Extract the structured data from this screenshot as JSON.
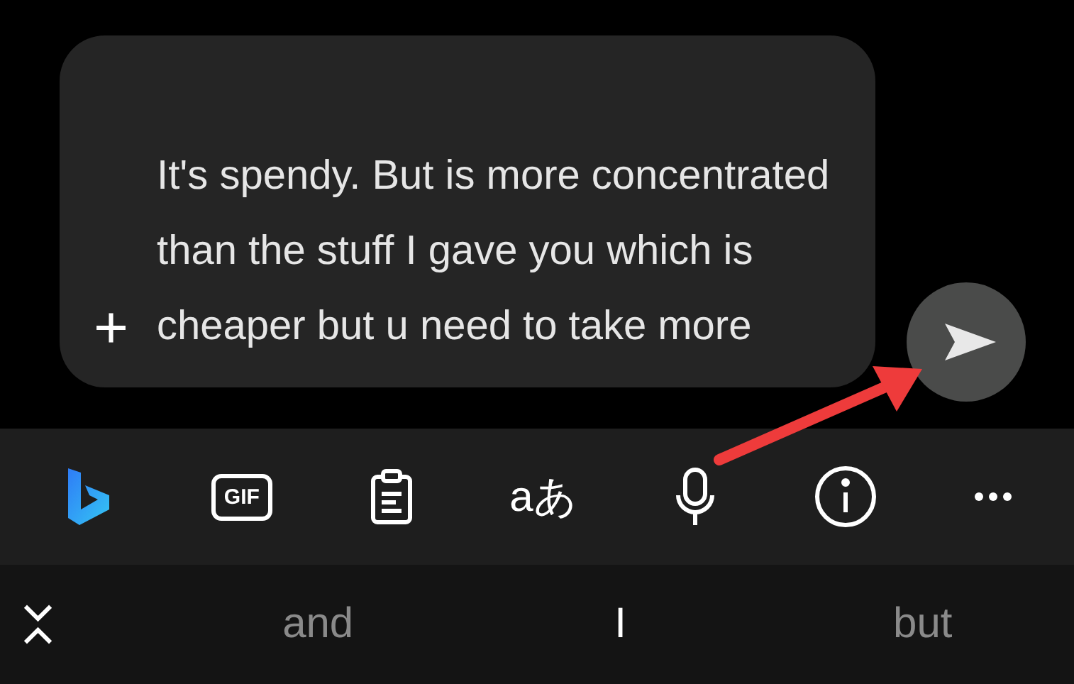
{
  "composer": {
    "value": "It's spendy. But is more concentrated than the stuff I gave you which is cheaper but u need to take more",
    "add_label": "+"
  },
  "toolbar": [
    {
      "kind": "bing"
    },
    {
      "kind": "gif",
      "label": "GIF"
    },
    {
      "kind": "clipboard"
    },
    {
      "kind": "translate",
      "label": "aあ"
    },
    {
      "kind": "mic"
    },
    {
      "kind": "info"
    },
    {
      "kind": "more"
    }
  ],
  "suggestions": [
    {
      "text": "and",
      "highlighted": false
    },
    {
      "text": "I",
      "highlighted": true
    },
    {
      "text": "but",
      "highlighted": false
    }
  ],
  "annotation": {
    "kind": "arrow"
  }
}
